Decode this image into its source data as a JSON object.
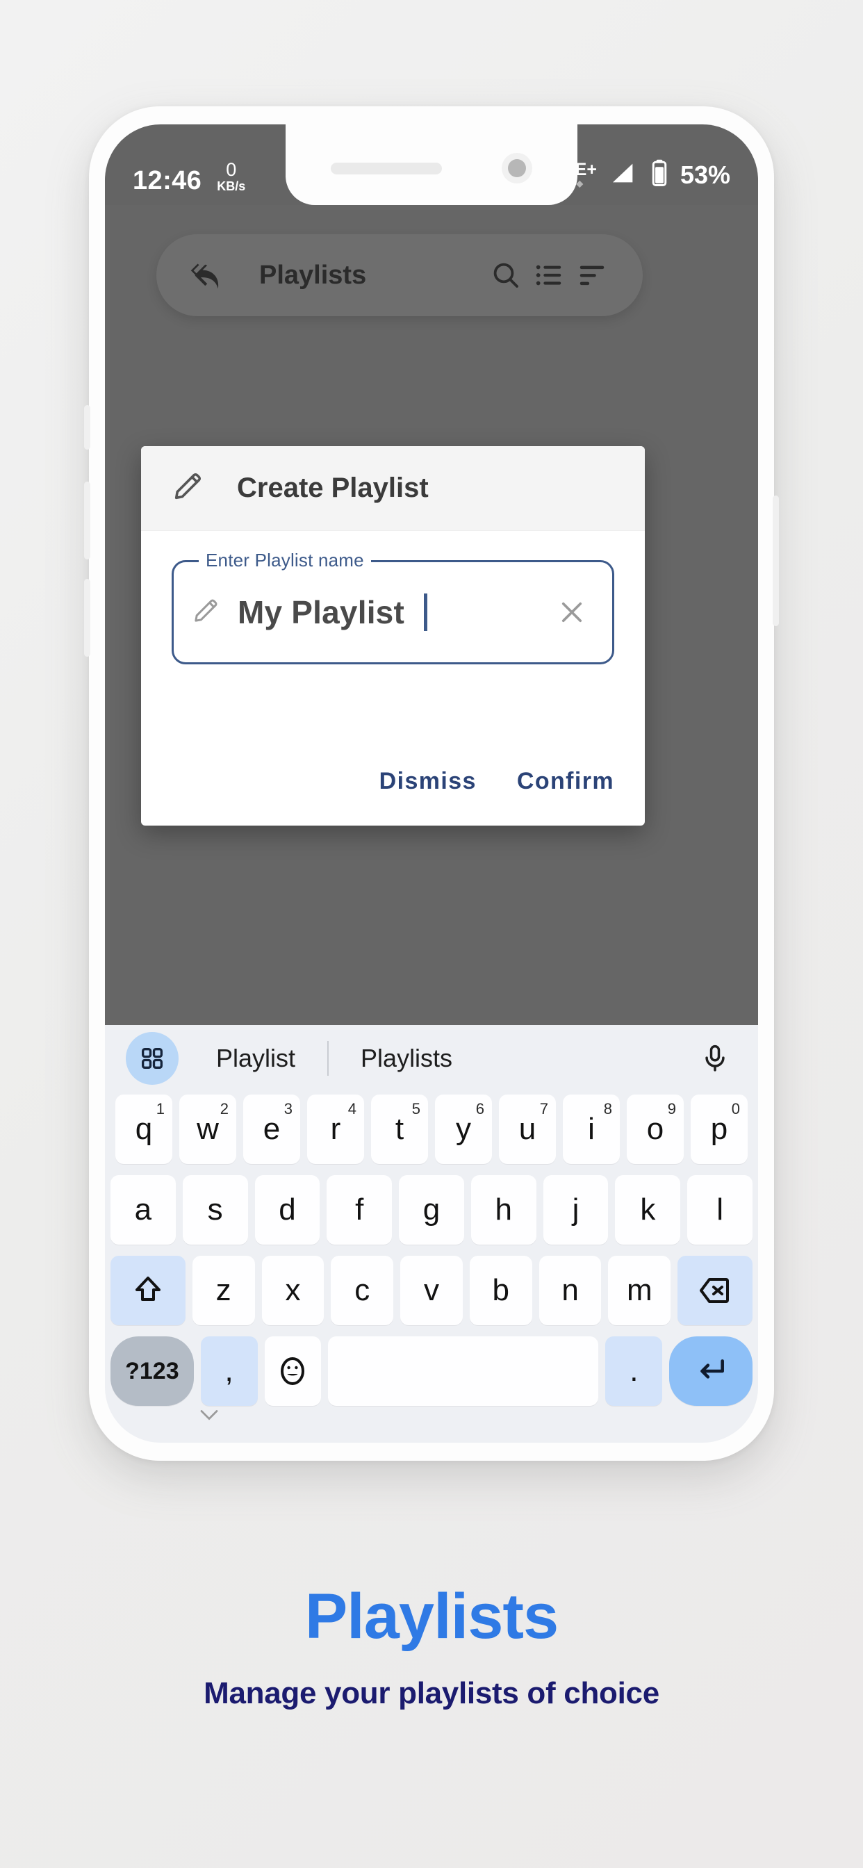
{
  "status_bar": {
    "time": "12:46",
    "net_speed_value": "0",
    "net_speed_unit": "KB/s",
    "network_type": "LTE+",
    "battery": "53%"
  },
  "app": {
    "toolbar": {
      "title": "Playlists",
      "back_icon": "back-arrow-icon",
      "search_icon": "search-icon",
      "list_icon": "list-view-icon",
      "sort_icon": "sort-icon"
    }
  },
  "dialog": {
    "title": "Create Playlist",
    "title_icon": "pencil-icon",
    "field": {
      "label": "Enter Playlist name",
      "value": "My Playlist",
      "icon": "pencil-icon",
      "clear_icon": "close-icon"
    },
    "dismiss_label": "Dismiss",
    "confirm_label": "Confirm"
  },
  "keyboard": {
    "suggestions": {
      "grid_icon": "grid-icon",
      "word_1": "Playlist",
      "word_2": "Playlists",
      "mic_icon": "microphone-icon"
    },
    "row1": [
      {
        "key": "q",
        "sup": "1"
      },
      {
        "key": "w",
        "sup": "2"
      },
      {
        "key": "e",
        "sup": "3"
      },
      {
        "key": "r",
        "sup": "4"
      },
      {
        "key": "t",
        "sup": "5"
      },
      {
        "key": "y",
        "sup": "6"
      },
      {
        "key": "u",
        "sup": "7"
      },
      {
        "key": "i",
        "sup": "8"
      },
      {
        "key": "o",
        "sup": "9"
      },
      {
        "key": "p",
        "sup": "0"
      }
    ],
    "row2": [
      "a",
      "s",
      "d",
      "f",
      "g",
      "h",
      "j",
      "k",
      "l"
    ],
    "row3": [
      "z",
      "x",
      "c",
      "v",
      "b",
      "n",
      "m"
    ],
    "shift_icon": "shift-icon",
    "delete_icon": "backspace-icon",
    "num_label": "?123",
    "comma_label": ",",
    "emoji_icon": "emoji-icon",
    "space_label": "",
    "period_label": ".",
    "enter_icon": "enter-icon",
    "hide_icon": "chevron-down-icon"
  },
  "caption": {
    "title": "Playlists",
    "subtitle": "Manage your playlists of choice"
  },
  "colors": {
    "accent_blue": "#2f7ae5",
    "navy": "#1b1b6f",
    "dialog_action": "#2b4377",
    "field_border": "#3d5a8a",
    "status_bar_bg": "#646464",
    "dim_bg": "#666666",
    "key_fn": "#d3e3fa",
    "enter_key": "#8ec0f7"
  }
}
